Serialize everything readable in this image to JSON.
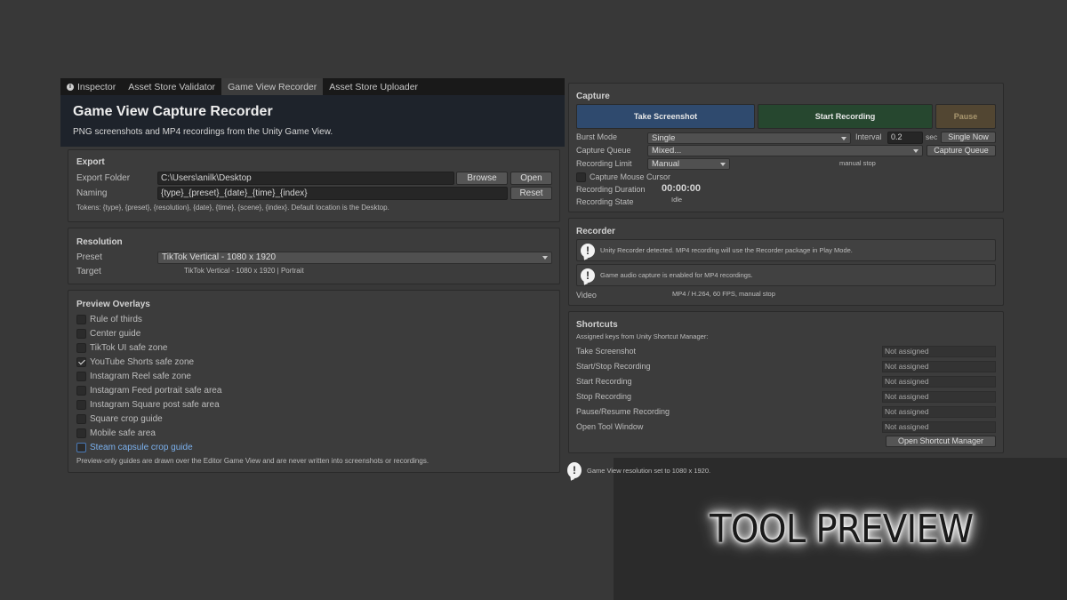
{
  "tabs": [
    {
      "label": "Inspector",
      "icon": "info-icon"
    },
    {
      "label": "Asset Store Validator"
    },
    {
      "label": "Game View Recorder"
    },
    {
      "label": "Asset Store Uploader"
    }
  ],
  "header": {
    "title": "Game View Capture Recorder",
    "subtitle": "PNG screenshots and MP4 recordings from the Unity Game View."
  },
  "export": {
    "title": "Export",
    "folder_label": "Export Folder",
    "folder_value": "C:\\Users\\anilk\\Desktop",
    "browse": "Browse",
    "open": "Open",
    "naming_label": "Naming",
    "naming_value": "{type}_{preset}_{date}_{time}_{index}",
    "reset": "Reset",
    "tokens": "Tokens: {type}, {preset}, {resolution}, {date}, {time}, {scene}, {index}. Default location is the Desktop."
  },
  "resolution": {
    "title": "Resolution",
    "preset_label": "Preset",
    "preset_value": "TikTok Vertical - 1080 x 1920",
    "target_label": "Target",
    "target_value": "TikTok Vertical - 1080 x 1920  |  Portrait"
  },
  "overlays": {
    "title": "Preview Overlays",
    "items": [
      {
        "label": "Rule of thirds",
        "checked": false
      },
      {
        "label": "Center guide",
        "checked": false
      },
      {
        "label": "TikTok UI safe zone",
        "checked": false
      },
      {
        "label": "YouTube Shorts safe zone",
        "checked": true
      },
      {
        "label": "Instagram Reel safe zone",
        "checked": false
      },
      {
        "label": "Instagram Feed portrait safe area",
        "checked": false
      },
      {
        "label": "Instagram Square post safe area",
        "checked": false
      },
      {
        "label": "Square crop guide",
        "checked": false
      },
      {
        "label": "Mobile safe area",
        "checked": false
      },
      {
        "label": "Steam capsule crop guide",
        "checked": false
      }
    ],
    "note": "Preview-only guides are drawn over the Editor Game View and are never written into screenshots or recordings."
  },
  "capture": {
    "title": "Capture",
    "take_screenshot": "Take Screenshot",
    "start_recording": "Start Recording",
    "pause": "Pause",
    "burst_label": "Burst Mode",
    "burst_value": "Single",
    "interval_label": "Interval",
    "interval_value": "0.2",
    "interval_unit": "sec",
    "single_now": "Single Now",
    "queue_label": "Capture Queue",
    "queue_value": "Mixed...",
    "queue_button": "Capture Queue",
    "limit_label": "Recording Limit",
    "limit_value": "Manual",
    "limit_note": "manual stop",
    "mouse_label": "Capture Mouse Cursor",
    "duration_label": "Recording Duration",
    "duration_value": "00:00:00",
    "state_label": "Recording State",
    "state_value": "Idle",
    "colors": {
      "screenshot": "#2f4a6e",
      "record": "#26472f",
      "pause": "#524632"
    }
  },
  "recorder": {
    "title": "Recorder",
    "msg1": "Unity Recorder detected. MP4 recording will use the Recorder package in Play Mode.",
    "msg2": "Game audio capture is enabled for MP4 recordings.",
    "video_label": "Video",
    "video_value": "MP4 / H.264, 60 FPS, manual stop"
  },
  "shortcuts": {
    "title": "Shortcuts",
    "subtitle": "Assigned keys from Unity Shortcut Manager:",
    "items": [
      {
        "label": "Take Screenshot",
        "value": "Not assigned"
      },
      {
        "label": "Start/Stop Recording",
        "value": "Not assigned"
      },
      {
        "label": "Start Recording",
        "value": "Not assigned"
      },
      {
        "label": "Stop Recording",
        "value": "Not assigned"
      },
      {
        "label": "Pause/Resume Recording",
        "value": "Not assigned"
      },
      {
        "label": "Open Tool Window",
        "value": "Not assigned"
      }
    ],
    "open_manager": "Open Shortcut Manager"
  },
  "status": "Game View resolution set to 1080 x 1920.",
  "overlay_caption": "TOOL PREVIEW"
}
